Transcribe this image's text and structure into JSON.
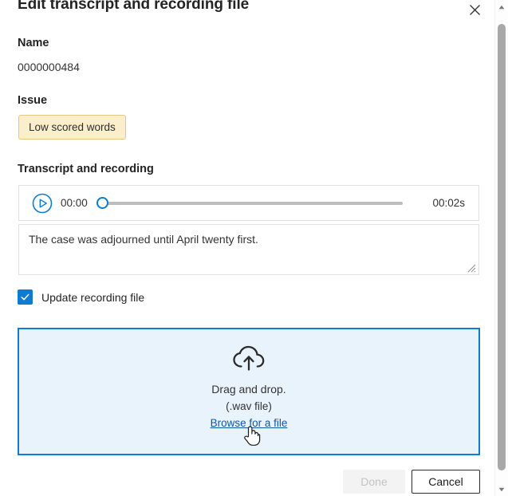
{
  "dialog": {
    "title": "Edit transcript and recording file",
    "close_icon": "close-icon"
  },
  "name_section": {
    "label": "Name",
    "value": "0000000484"
  },
  "issue_section": {
    "label": "Issue",
    "badge": "Low scored words",
    "badge_bg": "#fbeecb",
    "badge_border": "#e3c87f"
  },
  "transcript_section": {
    "label": "Transcript and recording",
    "player": {
      "play_icon": "play-icon",
      "current_time": "00:00",
      "total_time": "00:02s",
      "progress_percent": 0,
      "accent_color": "#0f7bd1"
    },
    "textarea_value": "The case was adjourned until April twenty first."
  },
  "update_recording": {
    "label": "Update recording file",
    "checked": true,
    "checkbox_color": "#0f7bd1"
  },
  "dropzone": {
    "icon": "cloud-upload-icon",
    "line1": "Drag and drop.",
    "line2": "(.wav file)",
    "link": "Browse for a file",
    "background": "#e9f3fb",
    "border_color": "#0f7bd1"
  },
  "footer": {
    "done_label": "Done",
    "done_disabled": true,
    "cancel_label": "Cancel"
  },
  "scrollbar": {
    "up_icon": "caret-up-icon",
    "down_icon": "caret-down-icon"
  },
  "cursor": {
    "type": "pointing-hand-cursor"
  }
}
